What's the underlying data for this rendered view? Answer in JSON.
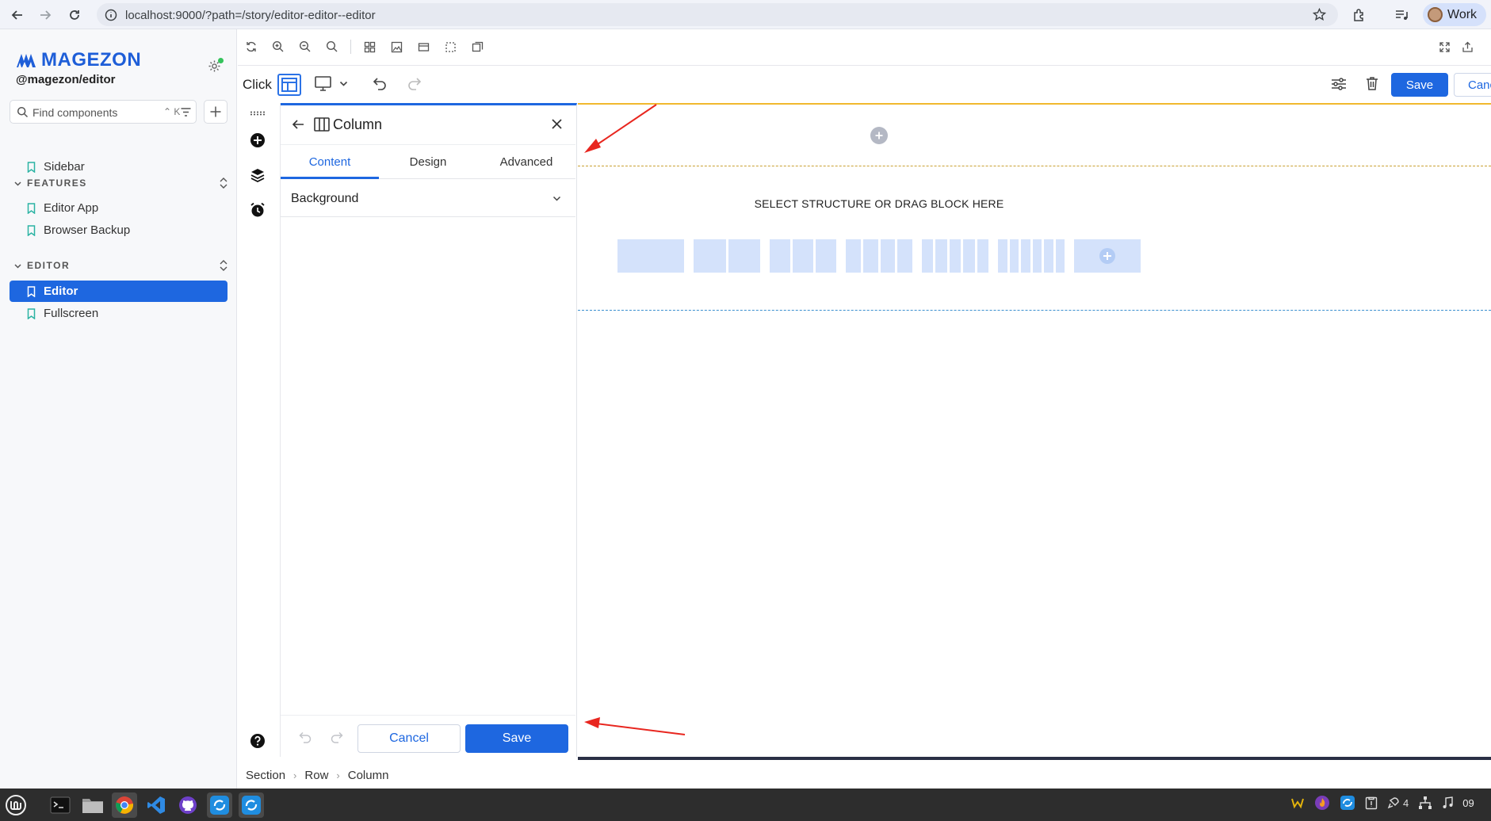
{
  "browser": {
    "url": "localhost:9000/?path=/story/editor-editor--editor",
    "profile_label": "Work"
  },
  "sidebar": {
    "brand": "MAGEZON",
    "package": "@magezon/editor",
    "search_placeholder": "Find components",
    "search_shortcut": "⌃ K",
    "top_item": "Sidebar",
    "groups": [
      {
        "title": "FEATURES",
        "items": [
          "Editor App",
          "Browser Backup"
        ]
      },
      {
        "title": "EDITOR",
        "items": [
          "Editor",
          "Fullscreen"
        ]
      }
    ],
    "active_item": "Editor"
  },
  "editor_bar": {
    "mode_label": "Click",
    "save_label": "Save",
    "cancel_label": "Canc"
  },
  "panel": {
    "title": "Column",
    "tabs": [
      "Content",
      "Design",
      "Advanced"
    ],
    "active_tab": "Content",
    "section_label": "Background",
    "cancel_label": "Cancel",
    "save_label": "Save"
  },
  "canvas": {
    "drop_hint": "SELECT STRUCTURE OR DRAG BLOCK HERE",
    "presets": [
      1,
      2,
      3,
      4,
      5,
      6,
      "plus"
    ]
  },
  "breadcrumb": [
    "Section",
    "Row",
    "Column"
  ],
  "taskbar": {
    "tray_count": "4",
    "clock": "09"
  },
  "colors": {
    "accent": "#1e67e0",
    "section_outline": "#f1b82e",
    "row_outline": "#3a8fcf",
    "preset_fill": "#d4e2fb",
    "annotation_arrow": "#e8261f"
  }
}
